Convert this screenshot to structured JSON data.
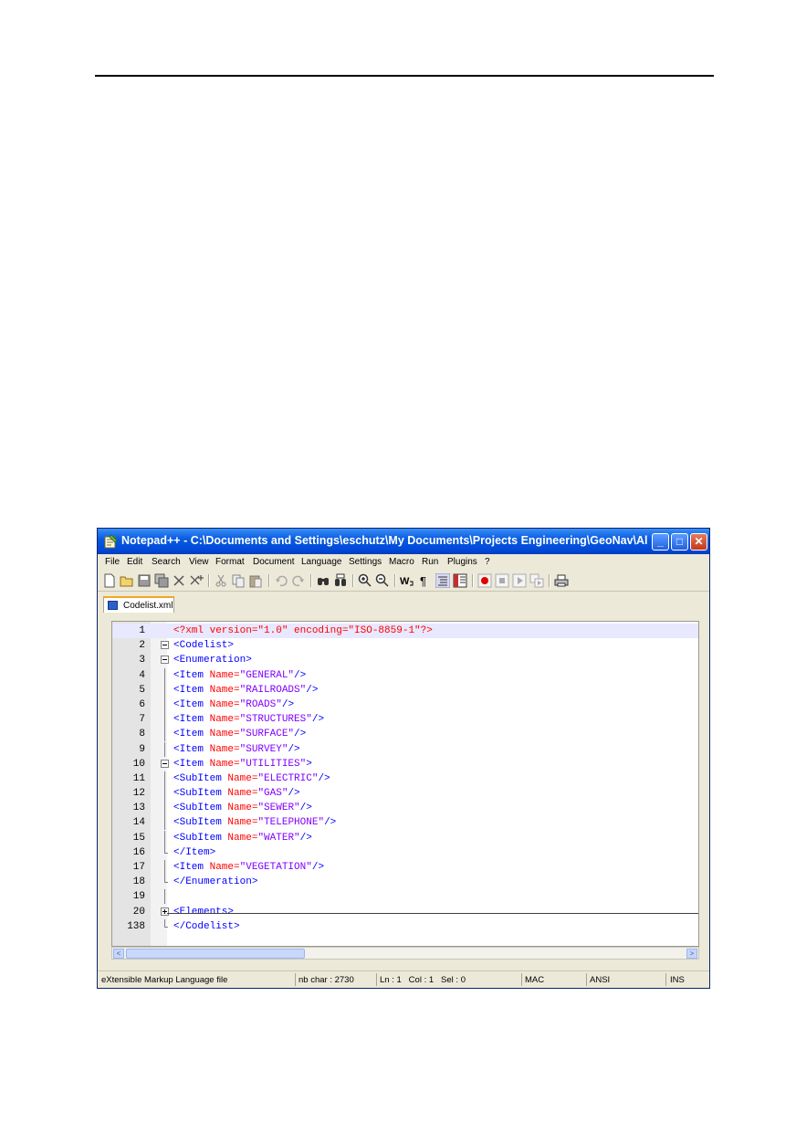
{
  "window": {
    "title": "Notepad++ - C:\\Documents and Settings\\eschutz\\My Documents\\Projects Engineering\\GeoNav\\Alion\\Man...",
    "controls": {
      "minimize": "_",
      "maximize": "□",
      "close": "✕"
    }
  },
  "menu": [
    "File",
    "Edit",
    "Search",
    "View",
    "Format",
    "Document",
    "Language",
    "Settings",
    "Macro",
    "Run",
    "Plugins",
    "?"
  ],
  "toolbar_icons": [
    "new-file-icon",
    "open-file-icon",
    "save-icon",
    "save-all-icon",
    "close-icon",
    "close-all-icon",
    "cut-icon",
    "copy-icon",
    "paste-icon",
    "undo-icon",
    "redo-icon",
    "find-icon",
    "replace-icon",
    "zoom-in-icon",
    "zoom-out-icon",
    "word-wrap-icon",
    "show-all-chars-icon",
    "indent-guide-icon",
    "view-panel-icon",
    "record-macro-icon",
    "stop-macro-icon",
    "play-macro-icon",
    "run-macro-multiple-icon",
    "print-icon"
  ],
  "tab": {
    "label": "Codelist.xml"
  },
  "editor": {
    "lines": [
      {
        "num": "1",
        "fold": "none",
        "decl": "<?xml version=\"1.0\" encoding=\"ISO-8859-1\"?>"
      },
      {
        "num": "2",
        "fold": "minus",
        "open": "<Codelist>"
      },
      {
        "num": "3",
        "fold": "minus",
        "open": "<Enumeration>"
      },
      {
        "num": "4",
        "fold": "line",
        "tag": "<Item ",
        "attr": "Name=",
        "val": "\"GENERAL\"",
        "close": "/>"
      },
      {
        "num": "5",
        "fold": "line",
        "tag": "<Item ",
        "attr": "Name=",
        "val": "\"RAILROADS\"",
        "close": "/>"
      },
      {
        "num": "6",
        "fold": "line",
        "tag": "<Item ",
        "attr": "Name=",
        "val": "\"ROADS\"",
        "close": "/>"
      },
      {
        "num": "7",
        "fold": "line",
        "tag": "<Item ",
        "attr": "Name=",
        "val": "\"STRUCTURES\"",
        "close": "/>"
      },
      {
        "num": "8",
        "fold": "line",
        "tag": "<Item ",
        "attr": "Name=",
        "val": "\"SURFACE\"",
        "close": "/>"
      },
      {
        "num": "9",
        "fold": "line",
        "tag": "<Item ",
        "attr": "Name=",
        "val": "\"SURVEY\"",
        "close": "/>"
      },
      {
        "num": "10",
        "fold": "minus",
        "tag": "<Item ",
        "attr": "Name=",
        "val": "\"UTILITIES\"",
        "close": ">"
      },
      {
        "num": "11",
        "fold": "line",
        "tag": "<SubItem ",
        "attr": "Name=",
        "val": "\"ELECTRIC\"",
        "close": "/>"
      },
      {
        "num": "12",
        "fold": "line",
        "tag": "<SubItem ",
        "attr": "Name=",
        "val": "\"GAS\"",
        "close": "/>"
      },
      {
        "num": "13",
        "fold": "line",
        "tag": "<SubItem ",
        "attr": "Name=",
        "val": "\"SEWER\"",
        "close": "/>"
      },
      {
        "num": "14",
        "fold": "line",
        "tag": "<SubItem ",
        "attr": "Name=",
        "val": "\"TELEPHONE\"",
        "close": "/>"
      },
      {
        "num": "15",
        "fold": "line",
        "tag": "<SubItem ",
        "attr": "Name=",
        "val": "\"WATER\"",
        "close": "/>"
      },
      {
        "num": "16",
        "fold": "end",
        "open": "</Item>"
      },
      {
        "num": "17",
        "fold": "line",
        "tag": "<Item ",
        "attr": "Name=",
        "val": "\"VEGETATION\"",
        "close": "/>"
      },
      {
        "num": "18",
        "fold": "end",
        "open": "</Enumeration>"
      },
      {
        "num": "19",
        "fold": "line",
        "open": ""
      },
      {
        "num": "20",
        "fold": "plus",
        "open": "<Elements>"
      },
      {
        "num": "138",
        "fold": "end",
        "open": "</Codelist>"
      }
    ]
  },
  "scrollbar": {
    "left_arrow": "<",
    "right_arrow": ">",
    "grip": "|||"
  },
  "status": {
    "file_type": "eXtensible Markup Language file",
    "nb_char": "nb char : 2730",
    "position": "Ln : 1   Col : 1   Sel : 0",
    "eol": "MAC",
    "encoding": "ANSI",
    "mode": "INS"
  },
  "colors": {
    "title_bar": "#0a5ce0",
    "tag": "#0000ff",
    "attribute": "#ff0000",
    "value": "#8000ff",
    "declaration": "#ff0000",
    "current_line": "#e8e8ff"
  }
}
